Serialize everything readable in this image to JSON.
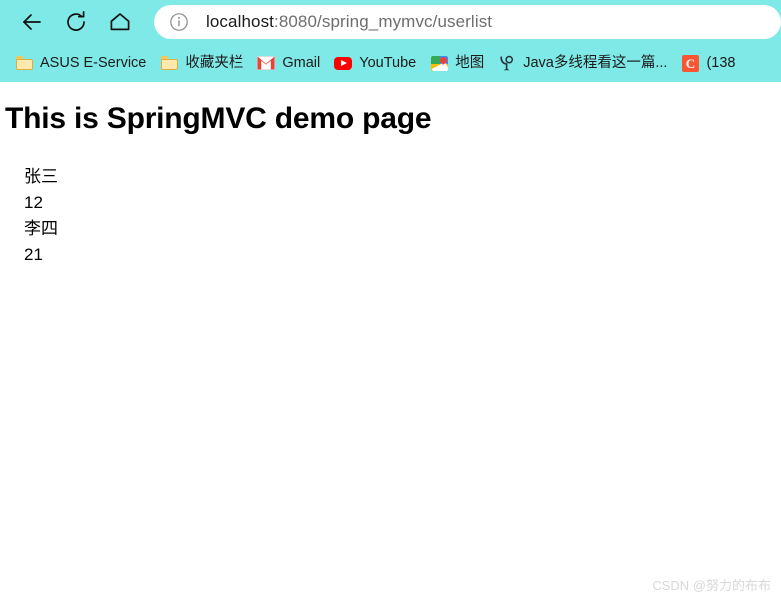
{
  "browser": {
    "nav": {
      "back_label": "Back",
      "reload_label": "Reload",
      "home_label": "Home"
    },
    "omnibox": {
      "info_icon": "info-circle-icon",
      "host": "localhost",
      "path": ":8080/spring_mymvc/userlist",
      "full_url": "localhost:8080/spring_mymvc/userlist"
    },
    "bookmarks": [
      {
        "label": "ASUS E-Service",
        "icon": "folder-icon"
      },
      {
        "label": "收藏夹栏",
        "icon": "folder-icon"
      },
      {
        "label": "Gmail",
        "icon": "gmail-icon"
      },
      {
        "label": "YouTube",
        "icon": "youtube-icon"
      },
      {
        "label": "地图",
        "icon": "google-maps-icon"
      },
      {
        "label": "Java多线程看这一篇...",
        "icon": "java-article-icon"
      },
      {
        "label": "(138",
        "icon": "csdn-icon"
      }
    ]
  },
  "page": {
    "title": "This is SpringMVC demo page",
    "users": [
      {
        "name": "张三",
        "age": "12"
      },
      {
        "name": "李四",
        "age": "21"
      }
    ],
    "watermark": "CSDN @努力的布布"
  },
  "colors": {
    "chrome_background": "#7FE9E7",
    "omnibox_background": "#ffffff",
    "page_background": "#ffffff",
    "text": "#000000",
    "url_path": "#6e6e6e",
    "watermark": "#D8D8D8"
  }
}
